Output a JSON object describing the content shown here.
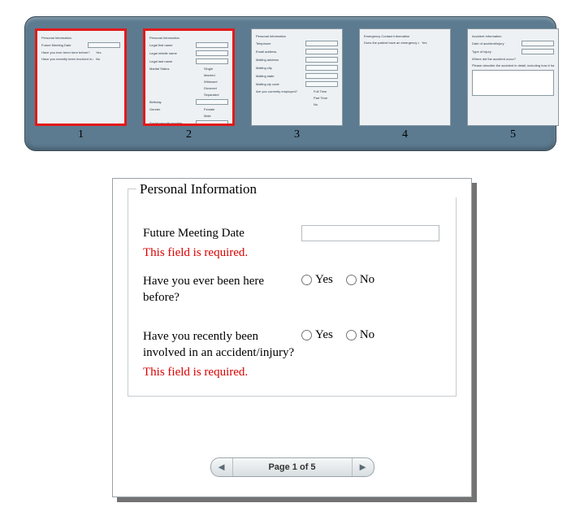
{
  "thumbs": [
    {
      "num": "1",
      "header": "Personal Information",
      "lines": [
        {
          "l": "Future Meeting Date",
          "t": "input"
        },
        {
          "l": "Have you ever been here before?",
          "t": "opt",
          "o": "Yes"
        },
        {
          "l": "Have you recently been involved in an accident/injury?",
          "t": "opt",
          "o": "No"
        }
      ]
    },
    {
      "num": "2",
      "header": "Personal Information",
      "lines": [
        {
          "l": "Legal first name",
          "t": "input"
        },
        {
          "l": "Legal middle name",
          "t": "input"
        },
        {
          "l": "Legal last name",
          "t": "input"
        },
        {
          "l": "Marital Status",
          "t": "text",
          "o": "Single"
        },
        {
          "l": "",
          "t": "text",
          "o": "Married"
        },
        {
          "l": "",
          "t": "text",
          "o": "Widowed"
        },
        {
          "l": "",
          "t": "text",
          "o": "Divorced"
        },
        {
          "l": "",
          "t": "text",
          "o": "Separated"
        },
        {
          "l": "Birthday",
          "t": "input"
        },
        {
          "l": "Gender",
          "t": "text",
          "o": "Female"
        },
        {
          "l": "",
          "t": "text",
          "o": "Male"
        },
        {
          "l": "Social security number",
          "t": "input"
        }
      ]
    },
    {
      "num": "3",
      "header": "Personal Information",
      "lines": [
        {
          "l": "Telephone",
          "t": "input"
        },
        {
          "l": "Email address",
          "t": "input"
        },
        {
          "l": "Mailing address",
          "t": "input"
        },
        {
          "l": "Mailing city",
          "t": "input"
        },
        {
          "l": "Mailing state",
          "t": "input"
        },
        {
          "l": "Mailing zip code",
          "t": "input"
        },
        {
          "l": "Are you currently employed?",
          "t": "text",
          "o": "Full Time"
        },
        {
          "l": "",
          "t": "text",
          "o": "Part Time"
        },
        {
          "l": "",
          "t": "text",
          "o": "No"
        }
      ]
    },
    {
      "num": "4",
      "header": "Emergency Contact Information",
      "lines": [
        {
          "l": "Does the patient have an emergency contact who does not live with them?",
          "t": "opt",
          "o": "Yes"
        }
      ]
    },
    {
      "num": "5",
      "header": "Accident Information",
      "lines": [
        {
          "l": "Date of accident/injury",
          "t": "input"
        },
        {
          "l": "Type of injury",
          "t": "input"
        },
        {
          "l": "Where did the accident occur?",
          "t": "none"
        },
        {
          "l": "Please describe the accident in detail, including how it happened, what happened, and if you were a pedestrian, driver or passenger.",
          "t": "none"
        },
        {
          "l": "",
          "t": "textarea"
        }
      ]
    }
  ],
  "form": {
    "legend": "Personal Information",
    "q1": {
      "label": "Future Meeting Date",
      "error": "This field is required."
    },
    "q2": {
      "label": "Have you ever been here before?",
      "yes": "Yes",
      "no": "No"
    },
    "q3": {
      "label": "Have you recently been involved in an accident/injury?",
      "yes": "Yes",
      "no": "No",
      "error": "This field is required."
    }
  },
  "pager": {
    "text": "Page 1 of 5"
  }
}
